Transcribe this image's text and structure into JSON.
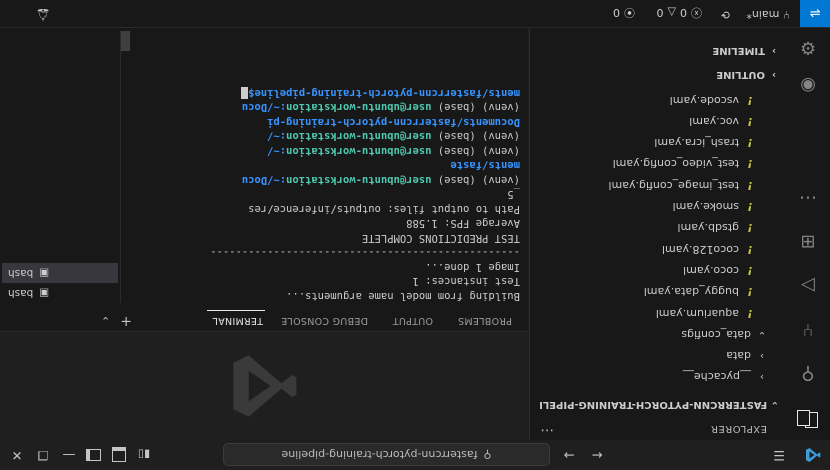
{
  "titlebar": {
    "search_text": "fasterrcnn-pytorch-training-pipeline",
    "menu_icon": "hamburger-menu-icon",
    "back_icon": "arrow-left-icon",
    "forward_icon": "arrow-right-icon"
  },
  "activity": {
    "items": [
      "explorer-icon",
      "search-icon",
      "source-control-icon",
      "run-debug-icon",
      "extensions-icon",
      "more-icon",
      "accounts-icon",
      "settings-gear-icon"
    ]
  },
  "explorer": {
    "title": "EXPLORER",
    "project": "FASTERRCNN-PYTORCH-TRAINING-PIPELI...",
    "tree": [
      {
        "label": "__pycache__",
        "kind": "folder",
        "collapsed": true
      },
      {
        "label": "data",
        "kind": "folder",
        "collapsed": true
      },
      {
        "label": "data_configs",
        "kind": "folder",
        "collapsed": false
      },
      {
        "label": "aquarium.yaml",
        "kind": "yaml"
      },
      {
        "label": "buggy_data.yaml",
        "kind": "yaml"
      },
      {
        "label": "coco.yaml",
        "kind": "yaml"
      },
      {
        "label": "coco128.yaml",
        "kind": "yaml"
      },
      {
        "label": "gtsdb.yaml",
        "kind": "yaml"
      },
      {
        "label": "smoke.yaml",
        "kind": "yaml"
      },
      {
        "label": "test_image_config.yaml",
        "kind": "yaml"
      },
      {
        "label": "test_video_config.yaml",
        "kind": "yaml"
      },
      {
        "label": "trash_icra.yaml",
        "kind": "yaml"
      },
      {
        "label": "voc.yaml",
        "kind": "yaml"
      },
      {
        "label": "vscode.yaml",
        "kind": "yaml"
      }
    ],
    "sections": {
      "outline": "OUTLINE",
      "timeline": "TIMELINE"
    }
  },
  "panel": {
    "tabs": [
      "PROBLEMS",
      "OUTPUT",
      "DEBUG CONSOLE",
      "TERMINAL"
    ],
    "active_tab": "TERMINAL",
    "terminal_lines": [
      {
        "t": "plain",
        "text": "Building from model name arguments..."
      },
      {
        "t": "plain",
        "text": "Test instances: 1"
      },
      {
        "t": "plain",
        "text": "Image 1 done..."
      },
      {
        "t": "plain",
        "text": "-------------------------------------------------"
      },
      {
        "t": "plain",
        "text": "TEST PREDICTIONS COMPLETE"
      },
      {
        "t": "plain",
        "text": "Average FPS: 1.588"
      },
      {
        "t": "plain",
        "text": "Path to output files: outputs/inference/res"
      },
      {
        "t": "plain",
        "text": "_5"
      },
      {
        "t": "prompt",
        "venv": "(venv) (base) ",
        "user": "user@ubuntu-workstation",
        "sep": ":~/Docu",
        "path": ""
      },
      {
        "t": "path",
        "text": "ments/faste"
      },
      {
        "t": "prompt",
        "venv": "(venv) (base) ",
        "user": "user@ubuntu-workstation",
        "sep": ":~/",
        "path": ""
      },
      {
        "t": "prompt",
        "venv": "(venv) (base) ",
        "user": "user@ubuntu-workstation",
        "sep": ":~/",
        "path": ""
      },
      {
        "t": "path",
        "text": "Documents/fasterrcnn-pytorch-training-pi"
      },
      {
        "t": "prompt",
        "venv": "(venv) (base) ",
        "user": "user@ubuntu-workstation",
        "sep": ":~/Docu",
        "path": ""
      },
      {
        "t": "path_cursor",
        "text": "ments/fasterrcnn-pytorch-training-pipeline$"
      }
    ],
    "terminals": [
      "bash",
      "bash"
    ],
    "active_terminal": 1
  },
  "statusbar": {
    "branch": "main*",
    "errors": "0",
    "warnings": "0",
    "ports": "0"
  }
}
